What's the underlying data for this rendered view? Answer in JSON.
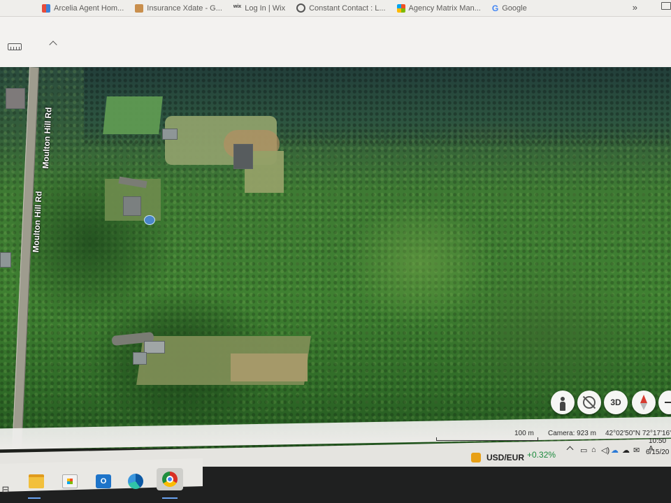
{
  "bookmarks": {
    "items": [
      {
        "label": "Arcelia Agent Hom...",
        "icon": "grid-icon"
      },
      {
        "label": "Insurance Xdate - G...",
        "icon": "doc-icon"
      },
      {
        "label": "Log In | Wix",
        "icon": "wix-icon"
      },
      {
        "label": "Constant Contact : L...",
        "icon": "globe-icon"
      },
      {
        "label": "Agency Matrix Man...",
        "icon": "windows-grid-icon"
      },
      {
        "label": "Google",
        "icon": "google-icon"
      }
    ],
    "more": "»"
  },
  "map": {
    "road_name": "Moulton Hill Rd",
    "controls": {
      "person": "street-view-icon",
      "locate": "locate-icon",
      "threed": "3D",
      "compass": "compass-icon",
      "zoom_out": "zoom-out-icon"
    }
  },
  "status": {
    "scale": "100 m",
    "camera": "Camera: 923 m",
    "coords": "42°02'50\"N 72°17'16\""
  },
  "tray": {
    "ticker_name": "USD/EUR",
    "ticker_change": "+0.32%",
    "time": "10:50 A",
    "date": "6/15/20"
  },
  "taskbar": {
    "apps": [
      "file-explorer-icon",
      "microsoft-store-icon",
      "outlook-icon",
      "edge-icon",
      "chrome-icon"
    ],
    "outlook_letter": "O"
  }
}
